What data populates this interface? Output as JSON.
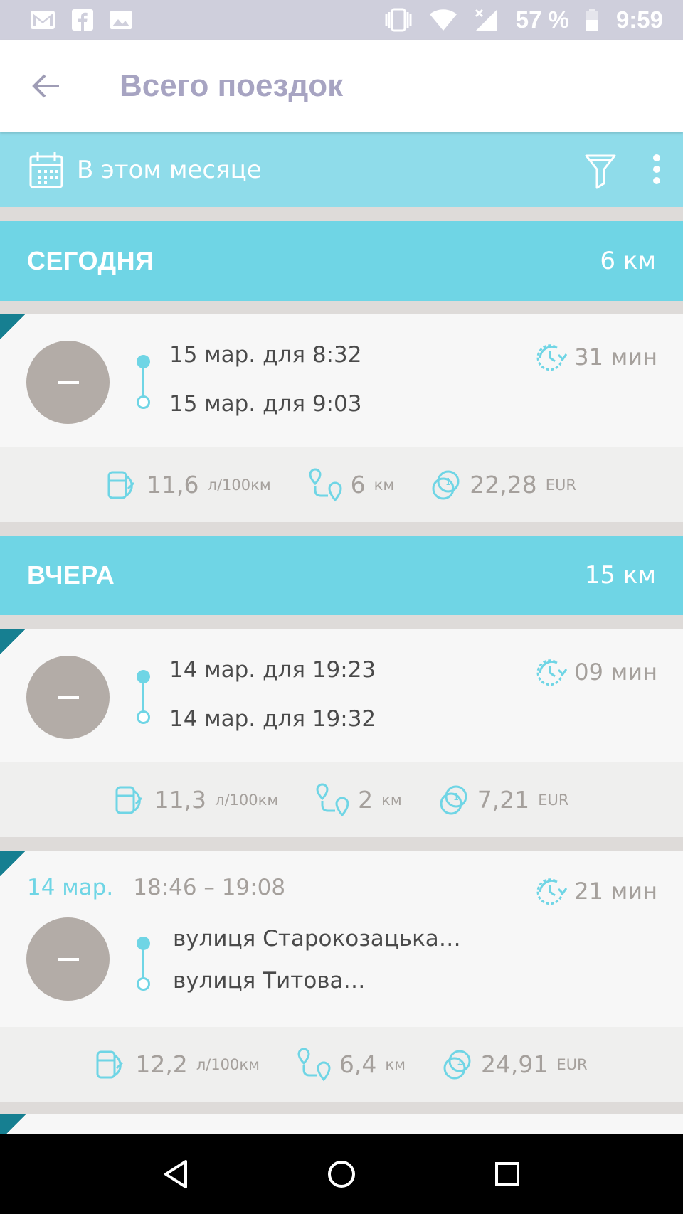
{
  "status_bar": {
    "battery": "57 %",
    "time": "9:59",
    "icons": [
      "gmail-icon",
      "facebook-icon",
      "gallery-icon",
      "vibrate-icon",
      "wifi-icon",
      "no-signal-icon",
      "battery-icon"
    ]
  },
  "header": {
    "title": "Всего поездок"
  },
  "filter": {
    "period": "В этом месяце"
  },
  "sections": [
    {
      "title": "СЕГОДНЯ",
      "total": "6 км"
    },
    {
      "title": "ВЧЕРА",
      "total": "15 км"
    }
  ],
  "trips": [
    {
      "start": "15 мар. для 8:32",
      "end": "15 мар. для 9:03",
      "duration": "31 мин",
      "consumption": "11,6",
      "consumption_unit": "л/100км",
      "distance": "6",
      "distance_unit": "км",
      "cost": "22,28",
      "cost_unit": "EUR"
    },
    {
      "start": "14 мар. для 19:23",
      "end": "14 мар. для 19:32",
      "duration": "09 мин",
      "consumption": "11,3",
      "consumption_unit": "л/100км",
      "distance": "2",
      "distance_unit": "км",
      "cost": "7,21",
      "cost_unit": "EUR"
    },
    {
      "date": "14 мар.",
      "time_range": "18:46 – 19:08",
      "start": "вулиця Старокозацька…",
      "end": "вулиця Титова…",
      "duration": "21 мин",
      "consumption": "12,2",
      "consumption_unit": "л/100км",
      "distance": "6,4",
      "distance_unit": "км",
      "cost": "24,91",
      "cost_unit": "EUR"
    }
  ],
  "colors": {
    "accent": "#6fd5e5",
    "filter_bar": "#8fdcea",
    "title": "#a7a4c2",
    "avatar": "#b3aca7",
    "corner": "#167f91"
  }
}
